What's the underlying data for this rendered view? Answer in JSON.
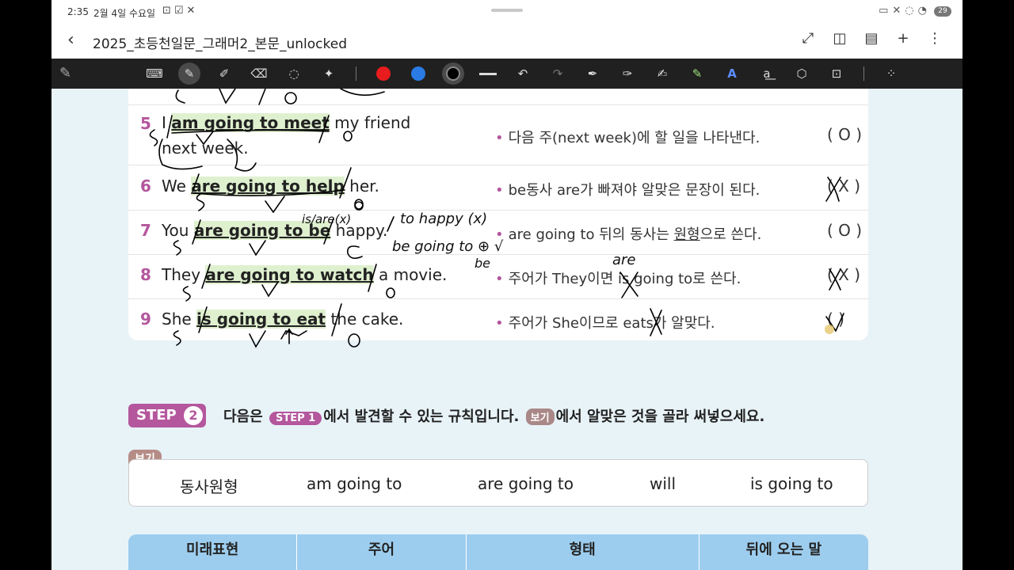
{
  "status": {
    "time": "2:35",
    "date": "2월 4일 수요일",
    "battery": "29"
  },
  "titlebar": {
    "title": "2025_초등천일문_그래머2_본문_unlocked"
  },
  "colors": {
    "accent": "#b4579d",
    "highlight": "#dff0cf",
    "pen_red": "#e81c1c",
    "pen_blue": "#2a7be4",
    "pen_black": "#000000",
    "table_head": "#9dcdee"
  },
  "rows": [
    {
      "num": "5",
      "pre": "I ",
      "hl": "am going to meet",
      "post": " my friend",
      "line2": "next week.",
      "exp_a": "다음 주(next week)에 할 일을 나타낸다.",
      "ans": "( O )"
    },
    {
      "num": "6",
      "pre": "We ",
      "hl": "are going to help",
      "post": " her.",
      "exp_a": "be동사 are가 빠져야 알맞은 문장이 된다.",
      "ans": "( X )"
    },
    {
      "num": "7",
      "pre": "You ",
      "hl": "are going to be",
      "post": " happy.",
      "exp_a": "are going to 뒤의 동사는 ",
      "exp_u": "원형",
      "exp_b": "으로 쓴다.",
      "ans": "( O )"
    },
    {
      "num": "8",
      "pre": "They ",
      "hl": "are going to watch",
      "post": " a movie.",
      "exp_a": "주어가 They이면 is going to로 쓴다.",
      "ans": "( X )"
    },
    {
      "num": "9",
      "pre": "She ",
      "hl": "is going to eat",
      "post": " the cake.",
      "exp_a": "주어가 She이므로 eats가 알맞다.",
      "ans": "(   )"
    }
  ],
  "step2": {
    "badge": "STEP",
    "num": "2",
    "text_a": "다음은",
    "mini_step": "STEP",
    "mini_num": "1",
    "text_b": "에서 발견할 수 있는 규칙입니다.",
    "bogi": "보기",
    "text_c": "에서 알맞은 것을 골라 써넣으세요."
  },
  "bogi_box": {
    "tag": "보기",
    "options": [
      "동사원형",
      "am going to",
      "are going to",
      "will",
      "is going to"
    ]
  },
  "table": {
    "headers": [
      "미래표현",
      "주어",
      "형태",
      "뒤에 오는 말"
    ]
  },
  "ink": {
    "note1": "is/are(x)",
    "note2": "to happy (x)",
    "note3": "be going to ⊕ √",
    "note4": "be",
    "note5": "are"
  }
}
